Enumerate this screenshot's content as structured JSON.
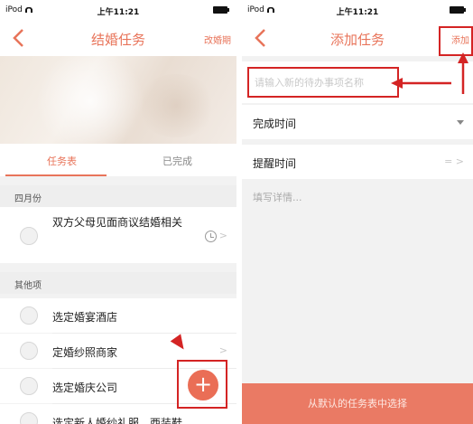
{
  "accent_color": "#e8745a",
  "annotation_color": "#d42424",
  "left_screen": {
    "status": {
      "carrier": "iPod",
      "time": "上午11:21"
    },
    "nav": {
      "back_icon": "chevron-left-icon",
      "title": "结婚任务",
      "right_label": "改婚期"
    },
    "tabs": [
      {
        "label": "任务表",
        "active": true
      },
      {
        "label": "已完成",
        "active": false
      }
    ],
    "sections": [
      {
        "title": "四月份",
        "items": [
          {
            "label": "双方父母见面商议结婚相关"
          }
        ]
      },
      {
        "title": "其他项",
        "items": [
          {
            "label": "选定婚宴酒店"
          },
          {
            "label": "定婚纱照商家"
          },
          {
            "label": "选定婚庆公司"
          },
          {
            "label": "选定新人婚纱礼服、西装鞋"
          }
        ]
      }
    ],
    "fab": {
      "icon": "plus-icon",
      "symbol": "+"
    }
  },
  "right_screen": {
    "status": {
      "carrier": "iPod",
      "time": "上午11:21"
    },
    "nav": {
      "back_icon": "chevron-left-icon",
      "title": "添加任务",
      "right_label": "添加"
    },
    "name_placeholder": "请输入新的待办事项名称",
    "due_label": "完成时间",
    "remind_label": "提醒时间",
    "details_placeholder": "填写详情...",
    "bottom_button": "从默认的任务表中选择"
  }
}
